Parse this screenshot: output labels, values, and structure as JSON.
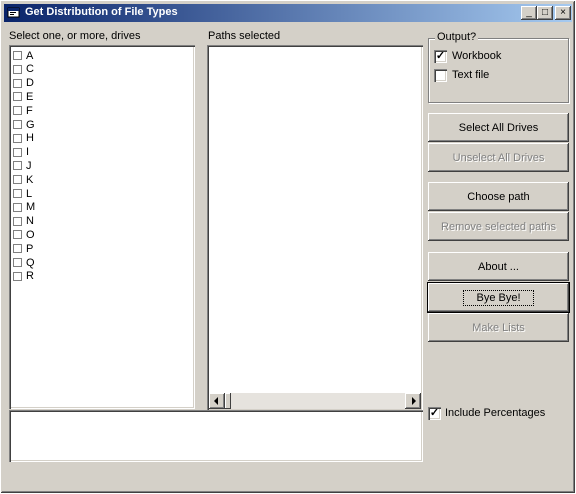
{
  "window": {
    "title": "Get Distribution of File Types",
    "minimize_glyph": "_",
    "maximize_glyph": "□",
    "close_glyph": "×"
  },
  "drives": {
    "label": "Select one, or more, drives",
    "items": [
      "A",
      "C",
      "D",
      "E",
      "F",
      "G",
      "H",
      "I",
      "J",
      "K",
      "L",
      "M",
      "N",
      "O",
      "P",
      "Q",
      "R"
    ]
  },
  "paths": {
    "label": "Paths selected"
  },
  "output": {
    "legend": "Output?",
    "workbook_label": "Workbook",
    "workbook_checked": true,
    "textfile_label": "Text file",
    "textfile_checked": false
  },
  "buttons": {
    "select_all": "Select All Drives",
    "unselect_all": "Unselect All Drives",
    "choose_path": "Choose path",
    "remove_paths": "Remove selected paths",
    "about": "About ...",
    "bye": "Bye Bye!",
    "make_lists": "Make Lists"
  },
  "include_percentages": {
    "label": "Include Percentages",
    "checked": true
  },
  "checkmark_glyph": "✓"
}
